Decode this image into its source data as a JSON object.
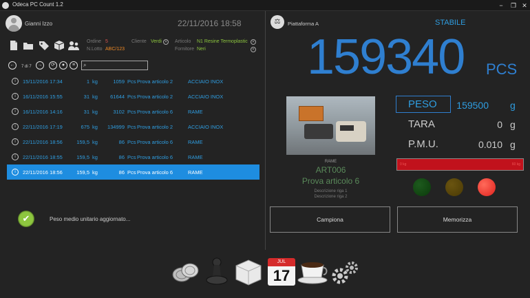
{
  "window": {
    "title": "Odeca PC Count 1.2",
    "min": "−",
    "max": "❐",
    "close": "✕"
  },
  "user": {
    "name": "Gianni Izzo"
  },
  "header": {
    "datetime": "22/11/2016  18:58"
  },
  "fields": {
    "ordine_label": "Ordine",
    "ordine_value": "5",
    "nlotto_label": "N.Lotto",
    "nlotto_value": "ABC/123",
    "cliente_label": "Cliente",
    "cliente_value": "Verdi",
    "articolo_label": "Articolo",
    "articolo_value": "N1 Resine Termoplastic",
    "fornitore_label": "Fornitore",
    "fornitore_value": "Neri",
    "clear": "✕"
  },
  "nav": {
    "page": "7 di 7",
    "search_placeholder": ""
  },
  "table": {
    "rows": [
      {
        "date": "15/11/2016 17:34",
        "qty": "1",
        "unit": "kg",
        "pcs": "1059",
        "pcs_label": "Pcs",
        "product": "Prova articolo 2",
        "material": "ACCIAIO INOX"
      },
      {
        "date": "16/11/2016 15:55",
        "qty": "31",
        "unit": "kg",
        "pcs": "61644",
        "pcs_label": "Pcs",
        "product": "Prova articolo 2",
        "material": "ACCIAIO INOX"
      },
      {
        "date": "16/11/2016 14:16",
        "qty": "31",
        "unit": "kg",
        "pcs": "3102",
        "pcs_label": "Pcs",
        "product": "Prova articolo 6",
        "material": "RAME"
      },
      {
        "date": "22/11/2016 17:19",
        "qty": "675",
        "unit": "kg",
        "pcs": "134999",
        "pcs_label": "Pcs",
        "product": "Prova articolo 2",
        "material": "ACCIAIO INOX"
      },
      {
        "date": "22/11/2016 18:56",
        "qty": "159,5",
        "unit": "kg",
        "pcs": "86",
        "pcs_label": "Pcs",
        "product": "Prova articolo 6",
        "material": "RAME"
      },
      {
        "date": "22/11/2016 18:55",
        "qty": "159,5",
        "unit": "kg",
        "pcs": "86",
        "pcs_label": "Pcs",
        "product": "Prova articolo 6",
        "material": "RAME"
      },
      {
        "date": "22/11/2016 18:56",
        "qty": "159,5",
        "unit": "kg",
        "pcs": "86",
        "pcs_label": "Pcs",
        "product": "Prova articolo 6",
        "material": "RAME"
      }
    ],
    "selected_index": 6,
    "info_glyph": "i"
  },
  "status": {
    "message": "Peso medio unitario aggiornato...",
    "check": "✔"
  },
  "platform": {
    "name": "Piattaforma A",
    "state": "STABILE",
    "icon_glyph": "⚖"
  },
  "count": {
    "value": "159340",
    "unit": "PCS"
  },
  "product": {
    "material": "RAME",
    "code": "ART006",
    "name": "Prova articolo 6",
    "desc1": "Descrizione riga 1",
    "desc2": "Descrizione riga 2"
  },
  "weights": {
    "peso_label": "PESO",
    "peso_value": "159500",
    "peso_unit": "g",
    "tara_label": "TARA",
    "tara_value": "0",
    "tara_unit": "g",
    "pmu_label": "P.M.U.",
    "pmu_value": "0.010",
    "pmu_unit": "g"
  },
  "bar": {
    "low": "0 kg",
    "high": "60 kg"
  },
  "lights": {
    "green": "#0b3a0b",
    "yellow": "#4a3a05",
    "red": "#e0221d"
  },
  "buttons": {
    "campiona": "Campiona",
    "memorizza": "Memorizza"
  },
  "dock": {
    "calendar_month": "JUL",
    "calendar_day": "17"
  },
  "colors": {
    "accent": "#2f9de0",
    "selected_row": "#1e8de0",
    "count": "#2f7fd0",
    "bar": "#c1121c"
  }
}
